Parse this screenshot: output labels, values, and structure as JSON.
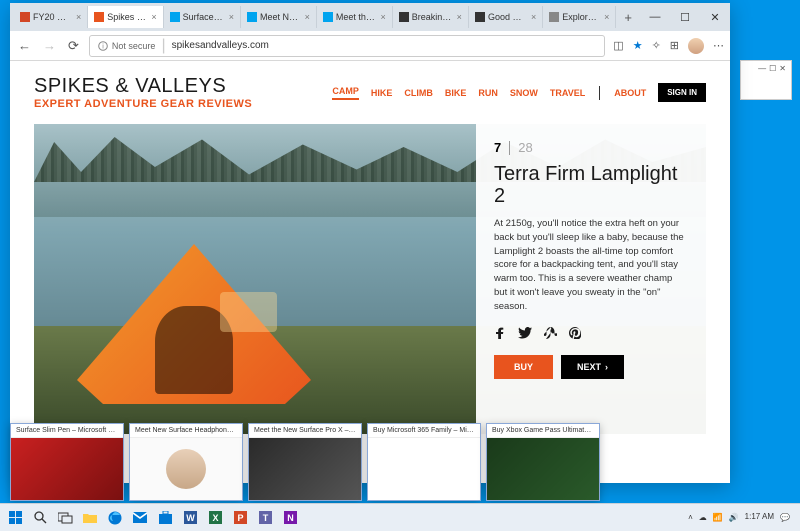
{
  "tabs": [
    {
      "title": "FY20 Plann…",
      "favicon": "#d24726"
    },
    {
      "title": "Spikes & Va…",
      "favicon": "#e8541e",
      "active": true
    },
    {
      "title": "Surface Slim…",
      "favicon": "#00a4ef"
    },
    {
      "title": "Meet New S…",
      "favicon": "#00a4ef"
    },
    {
      "title": "Meet the Ne…",
      "favicon": "#00a4ef"
    },
    {
      "title": "Breaking Ne…",
      "favicon": "#333"
    },
    {
      "title": "Good News…",
      "favicon": "#333"
    },
    {
      "title": "Explore the…",
      "favicon": "#888"
    }
  ],
  "address": {
    "secure_label": "Not secure",
    "url": "spikesandvalleys.com"
  },
  "site": {
    "logo_title": "SPIKES & VALLEYS",
    "logo_sub": "EXPERT ADVENTURE GEAR REVIEWS",
    "nav": [
      "CAMP",
      "HIKE",
      "CLIMB",
      "BIKE",
      "RUN",
      "SNOW",
      "TRAVEL"
    ],
    "nav_active": "CAMP",
    "about": "ABOUT",
    "signin": "SIGN IN"
  },
  "product": {
    "index": "7",
    "total": "28",
    "title": "Terra Firm Lamplight 2",
    "desc": "At 2150g, you'll notice the extra heft on your back but you'll sleep like a baby, because the Lamplight 2 boasts the all-time top comfort score for a backpacking tent, and you'll stay warm too. This is a severe weather champ but it won't leave you sweaty in the \"on\" season.",
    "buy": "BUY",
    "next": "NEXT"
  },
  "task_previews": [
    "Surface Slim Pen – Microsoft S…",
    "Meet New Surface Headphones…",
    "Meet the New Surface Pro X –…",
    "Buy Microsoft 365 Family – Mic…",
    "Buy Xbox Game Pass Ultimate…"
  ],
  "tray": {
    "time": "1:17 AM"
  }
}
